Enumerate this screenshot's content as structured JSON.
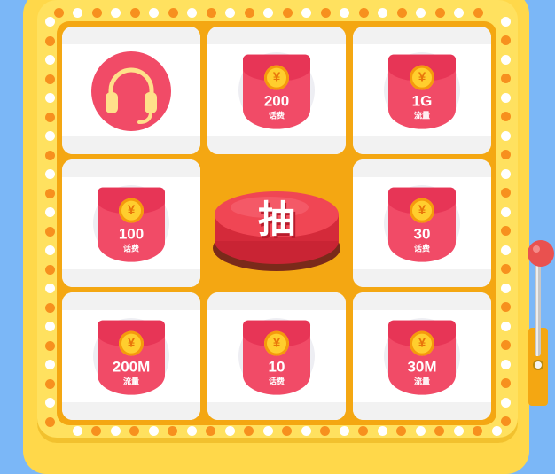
{
  "colors": {
    "background": "#7bb7f7",
    "machine": "#ffd84a",
    "board": "#f4a712",
    "envelope": "#f14b67",
    "coin": "#ffce2e",
    "light_orange": "#f7901e",
    "light_white": "#ffffff"
  },
  "center_button": {
    "label": "抽",
    "icon": "draw-button"
  },
  "prizes": [
    {
      "type": "service",
      "icon": "headset-icon"
    },
    {
      "type": "red-packet",
      "coin": "¥",
      "amount": "200",
      "unit": "话费"
    },
    {
      "type": "red-packet",
      "coin": "¥",
      "amount": "1G",
      "unit": "流量"
    },
    {
      "type": "red-packet",
      "coin": "¥",
      "amount": "100",
      "unit": "话费"
    },
    {
      "type": "red-packet",
      "coin": "¥",
      "amount": "30",
      "unit": "话费"
    },
    {
      "type": "red-packet",
      "coin": "¥",
      "amount": "200M",
      "unit": "流量"
    },
    {
      "type": "red-packet",
      "coin": "¥",
      "amount": "10",
      "unit": "话费"
    },
    {
      "type": "red-packet",
      "coin": "¥",
      "amount": "30M",
      "unit": "流量"
    }
  ]
}
